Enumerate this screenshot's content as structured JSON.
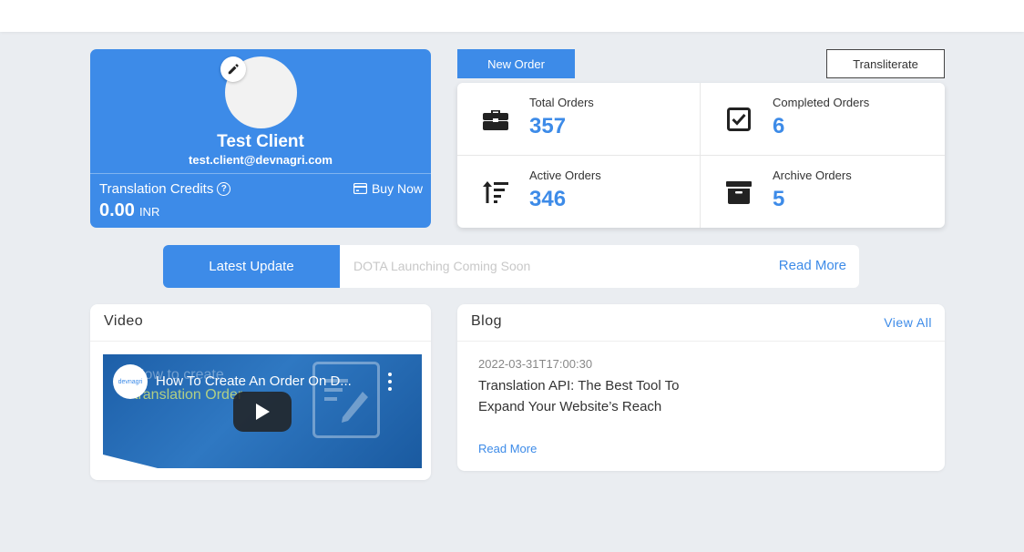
{
  "profile": {
    "name": "Test Client",
    "email": "test.client@devnagri.com",
    "credits_label": "Translation Credits",
    "credits_value": "0.00",
    "credits_currency": "INR",
    "buy_now_label": "Buy Now",
    "icons": {
      "edit": "pencil-icon",
      "help": "question-circle-icon",
      "buy": "credit-card-icon"
    }
  },
  "actions": {
    "new_order_label": "New Order",
    "transliterate_label": "Transliterate"
  },
  "stats": [
    {
      "label": "Total Orders",
      "value": "357",
      "icon": "briefcase-icon"
    },
    {
      "label": "Completed Orders",
      "value": "6",
      "icon": "checkbox-icon"
    },
    {
      "label": "Active Orders",
      "value": "346",
      "icon": "sort-icon"
    },
    {
      "label": "Archive Orders",
      "value": "5",
      "icon": "archive-icon"
    }
  ],
  "latest_update": {
    "label": "Latest Update",
    "text": "DOTA Launching Coming Soon",
    "read_more": "Read More"
  },
  "video": {
    "title": "Video",
    "video_title": "How To Create An Order On D...",
    "thumbnail_text_1": "How to create",
    "thumbnail_text_2": "translation Order",
    "channel_logo": "devnagri"
  },
  "blog": {
    "title": "Blog",
    "view_all": "View All",
    "post_date": "2022-03-31T17:00:30",
    "post_title": "Translation API: The Best Tool To Expand Your Website’s Reach",
    "read_more": "Read More"
  },
  "colors": {
    "accent": "#3d8be8",
    "background": "#eaedf1"
  }
}
